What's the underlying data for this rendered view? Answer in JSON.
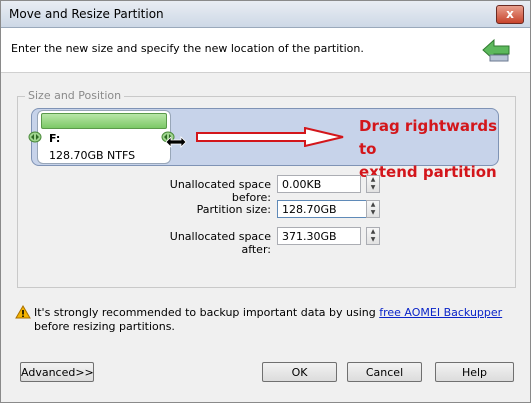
{
  "window": {
    "title": "Move and Resize Partition",
    "close_glyph": "x"
  },
  "header": {
    "instruction": "Enter the new size and specify the new location of the partition.",
    "icon": "back-arrow-icon"
  },
  "group": {
    "legend": "Size and Position"
  },
  "partition": {
    "letter": "F:",
    "size_fs": "128.70GB NTFS",
    "bar_color": "#7cc967"
  },
  "annotation": {
    "line1": "Drag rightwards to",
    "line2": "extend partition",
    "color": "#d3161b"
  },
  "fields": {
    "unallocated_before": {
      "label": "Unallocated space before:",
      "value": "0.00KB"
    },
    "partition_size": {
      "label": "Partition size:",
      "value": "128.70GB"
    },
    "unallocated_after": {
      "label": "Unallocated space after:",
      "value": "371.30GB"
    }
  },
  "warning": {
    "text_before": "It's strongly recommended to backup important data by using ",
    "link": "free AOMEI Backupper",
    "text_after": " before resizing partitions."
  },
  "buttons": {
    "advanced": "Advanced>>",
    "ok": "OK",
    "cancel": "Cancel",
    "help": "Help"
  }
}
